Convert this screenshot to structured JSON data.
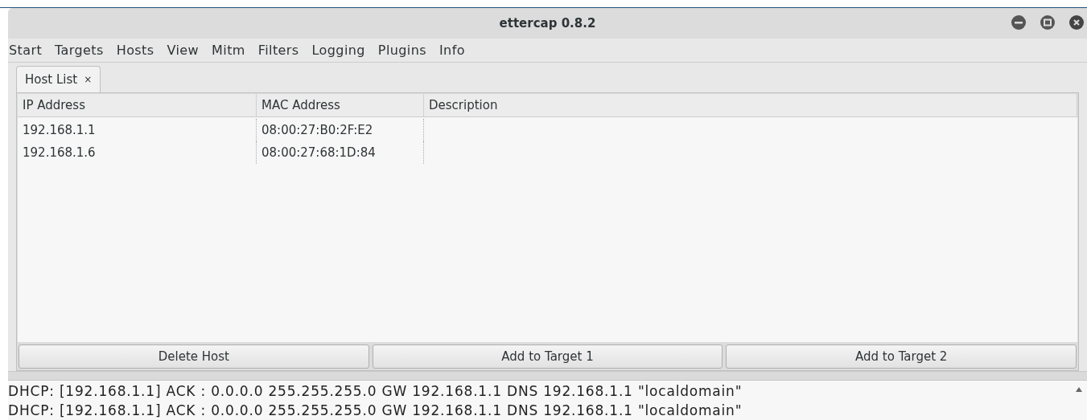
{
  "window": {
    "title": "ettercap 0.8.2"
  },
  "menu": [
    "Start",
    "Targets",
    "Hosts",
    "View",
    "Mitm",
    "Filters",
    "Logging",
    "Plugins",
    "Info"
  ],
  "tabs": [
    {
      "label": "Host List",
      "close": "×",
      "selected": true
    }
  ],
  "table": {
    "columns": [
      "IP Address",
      "MAC Address",
      "Description"
    ],
    "rows": [
      [
        "192.168.1.1",
        "08:00:27:B0:2F:E2"
      ],
      [
        "192.168.1.6",
        "08:00:27:68:1D:84"
      ]
    ]
  },
  "buttons": [
    "Delete Host",
    "Add to Target 1",
    "Add to Target 2"
  ],
  "log": [
    "DHCP: [192.168.1.1] ACK : 0.0.0.0 255.255.255.0 GW 192.168.1.1 DNS 192.168.1.1 \"localdomain\"",
    "DHCP: [192.168.1.1] ACK : 0.0.0.0 255.255.255.0 GW 192.168.1.1 DNS 192.168.1.1 \"localdomain\""
  ]
}
